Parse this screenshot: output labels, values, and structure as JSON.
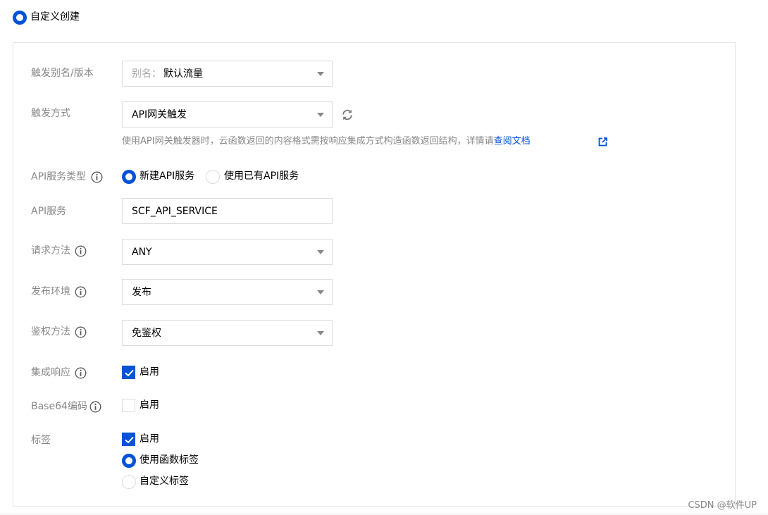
{
  "mode": {
    "label": "自定义创建",
    "selected": true
  },
  "form": {
    "alias": {
      "label": "触发别名/版本",
      "prefix": "别名：",
      "value": "默认流量"
    },
    "trigger": {
      "label": "触发方式",
      "value": "API网关触发",
      "hint": "使用API网关触发器时，云函数返回的内容格式需按响应集成方式构造函数返回结构，详情请",
      "hint_link": "查阅文档"
    },
    "api_service_type": {
      "label": "API服务类型",
      "options": [
        {
          "label": "新建API服务",
          "selected": true
        },
        {
          "label": "使用已有API服务",
          "selected": false
        }
      ]
    },
    "api_service": {
      "label": "API服务",
      "value": "SCF_API_SERVICE"
    },
    "request_method": {
      "label": "请求方法",
      "value": "ANY"
    },
    "environment": {
      "label": "发布环境",
      "value": "发布"
    },
    "auth_method": {
      "label": "鉴权方法",
      "value": "免鉴权"
    },
    "integrated_response": {
      "label": "集成响应",
      "checkbox_label": "启用",
      "checked": true
    },
    "base64": {
      "label": "Base64编码",
      "checkbox_label": "启用",
      "checked": false
    },
    "tags": {
      "label": "标签",
      "checkbox_label": "启用",
      "checked": true,
      "options": [
        {
          "label": "使用函数标签",
          "selected": true
        },
        {
          "label": "自定义标签",
          "selected": false
        }
      ]
    }
  },
  "watermark": "CSDN @软件UP",
  "colors": {
    "accent": "#0052d9",
    "label": "#888888",
    "border": "#dcdcdc"
  },
  "icons": [
    "info-icon",
    "refresh-icon",
    "external-link-icon",
    "check-icon",
    "caret-down-icon"
  ]
}
